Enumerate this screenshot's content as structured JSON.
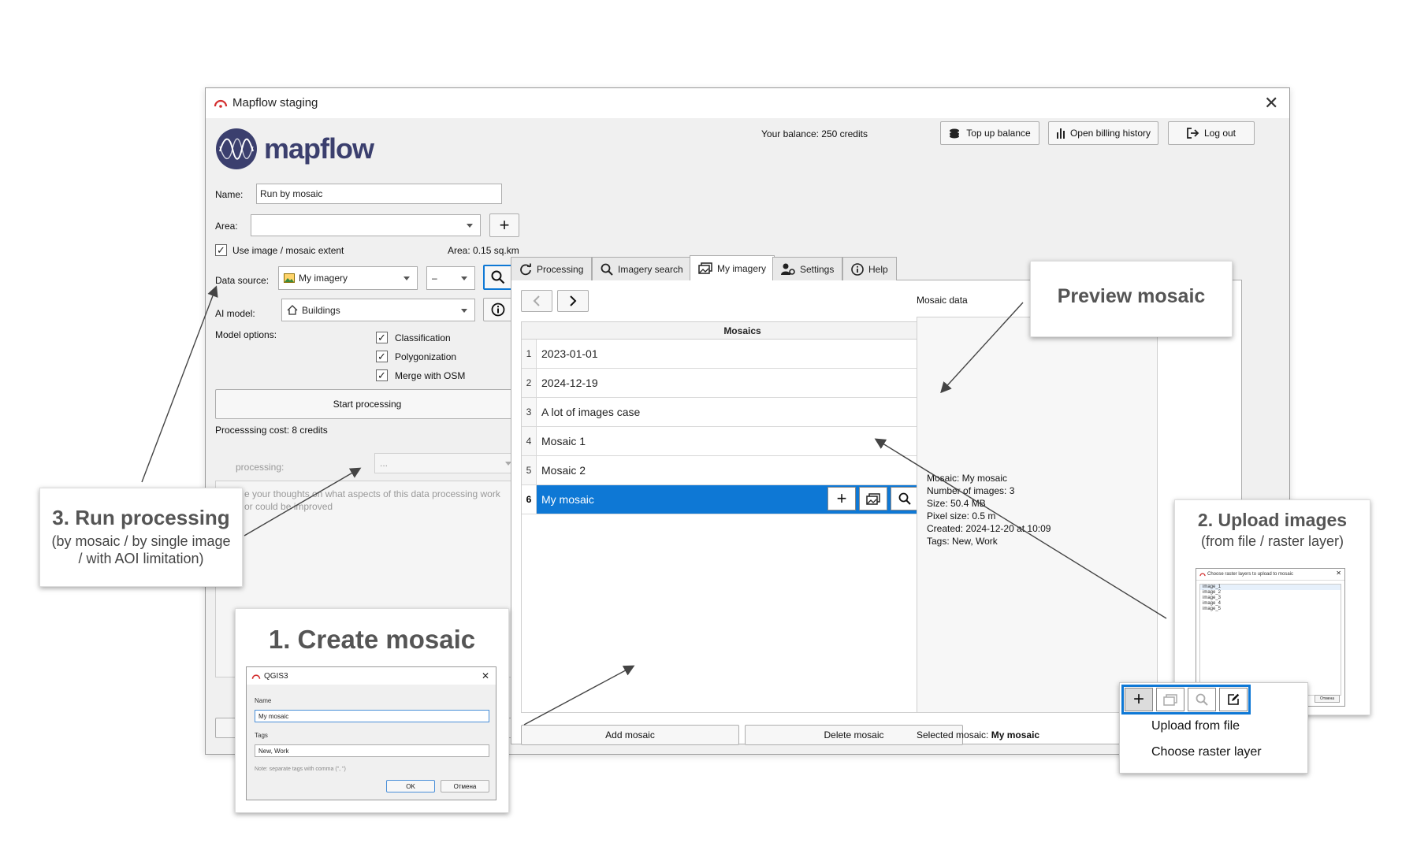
{
  "window": {
    "title": "Mapflow staging",
    "close_icon": "close-icon"
  },
  "logo": {
    "text": "mapflow"
  },
  "header": {
    "balance": "Your balance: 250 credits",
    "top_up": "Top up balance",
    "billing": "Open billing history",
    "logout": "Log out"
  },
  "left": {
    "name_label": "Name:",
    "name_value": "Run by mosaic",
    "area_label": "Area:",
    "use_extent": "Use image / mosaic extent",
    "area_value": "Area: 0.15 sq.km",
    "data_source_label": "Data source:",
    "data_source_value": "My imagery",
    "data_source_second": "–",
    "ai_model_label": "AI model:",
    "ai_model_value": "Buildings",
    "model_options_label": "Model options:",
    "options": [
      "Classification",
      "Polygonization",
      "Merge with OSM"
    ],
    "start": "Start processing",
    "cost": "Processsing cost: 8 credits",
    "rate_label": "processing:",
    "rate_value": "...",
    "feedback_placeholder": "e your thoughts on what aspects of this data processing work or could be improved"
  },
  "tabs": [
    "Processing",
    "Imagery search",
    "My imagery",
    "Settings",
    "Help"
  ],
  "mosaics": {
    "header": "Mosaics",
    "data_header": "Mosaic data",
    "rows": [
      {
        "n": "1",
        "name": "2023-01-01"
      },
      {
        "n": "2",
        "name": "2024-12-19"
      },
      {
        "n": "3",
        "name": "A lot of images case"
      },
      {
        "n": "4",
        "name": "Mosaic 1"
      },
      {
        "n": "5",
        "name": "Mosaic 2"
      },
      {
        "n": "6",
        "name": "My mosaic"
      }
    ],
    "details": [
      "Mosaic: My mosaic",
      "Number of images: 3",
      "Size: 50.4 MB",
      "Pixel size: 0.5 m",
      "Created: 2024-12-20 at 10:09",
      "Tags: New, Work"
    ],
    "add": "Add mosaic",
    "delete": "Delete mosaic",
    "selected_label": "Selected mosaic:",
    "selected_value": "My mosaic"
  },
  "callouts": {
    "preview": "Preview mosaic",
    "upload_title": "2. Upload images",
    "upload_sub": "(from file / raster layer)",
    "run_title": "3. Run processing",
    "run_sub_1": "(by mosaic / by single image",
    "run_sub_2": "/ with AOI limitation)",
    "create_title": "1. Create mosaic"
  },
  "dialog": {
    "title": "QGIS3",
    "name_label": "Name",
    "name_value": "My mosaic",
    "tags_label": "Tags",
    "tags_value": "New, Work",
    "note": "Note: separate tags with comma (\", \")",
    "ok": "OK",
    "cancel": "Отмена"
  },
  "upload_dialog": {
    "title": "Choose raster layers to upload to mosaic",
    "items": [
      "image_1",
      "image_2",
      "image_3",
      "image_4",
      "image_5"
    ],
    "cancel": "Отмена"
  },
  "upload_menu": {
    "items": [
      "Upload from file",
      "Choose raster layer"
    ]
  },
  "colors": {
    "accent": "#0e78d5",
    "logo": "#3b3f6e"
  }
}
